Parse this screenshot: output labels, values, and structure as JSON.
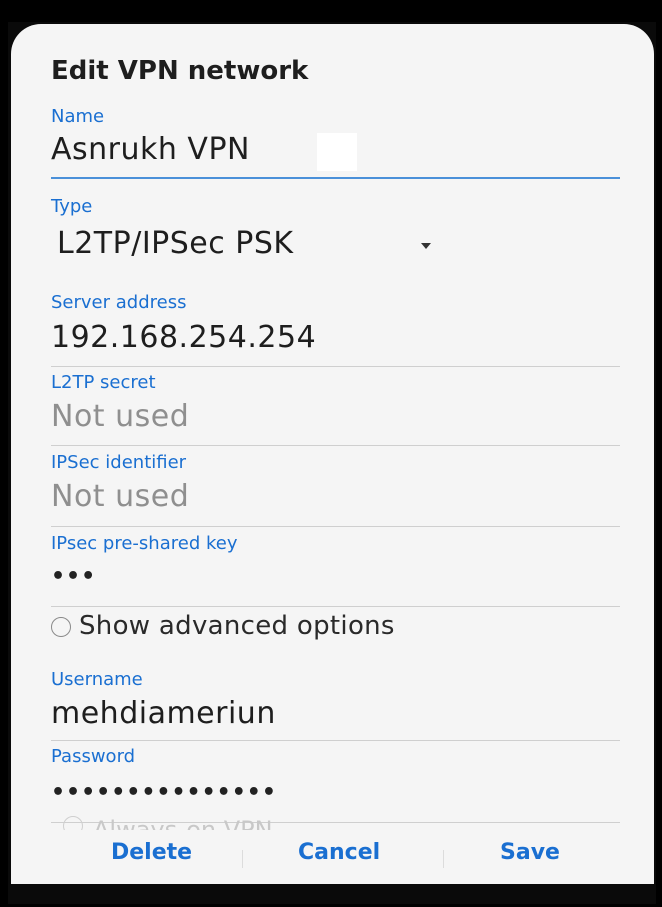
{
  "dialog": {
    "title": "Edit VPN network",
    "accent_color": "#1a6fd1",
    "name": {
      "label": "Name",
      "value": "Asnrukh VPN"
    },
    "type": {
      "label": "Type",
      "selected": "L2TP/IPSec PSK"
    },
    "server_address": {
      "label": "Server address",
      "value": "192.168.254.254"
    },
    "l2tp_secret": {
      "label": "L2TP secret",
      "placeholder": "Not used"
    },
    "ipsec_identifier": {
      "label": "IPSec identifier",
      "placeholder": "Not used"
    },
    "ipsec_psk": {
      "label": "IPsec pre-shared key",
      "masked_value": "•••"
    },
    "advanced": {
      "label": "Show advanced options",
      "checked": false
    },
    "username": {
      "label": "Username",
      "value": "mehdiameriun"
    },
    "password": {
      "label": "Password",
      "masked_value": "•••••••••••••••"
    },
    "always_on": {
      "label": "Always-on VPN"
    },
    "buttons": {
      "delete": "Delete",
      "cancel": "Cancel",
      "save": "Save"
    }
  }
}
